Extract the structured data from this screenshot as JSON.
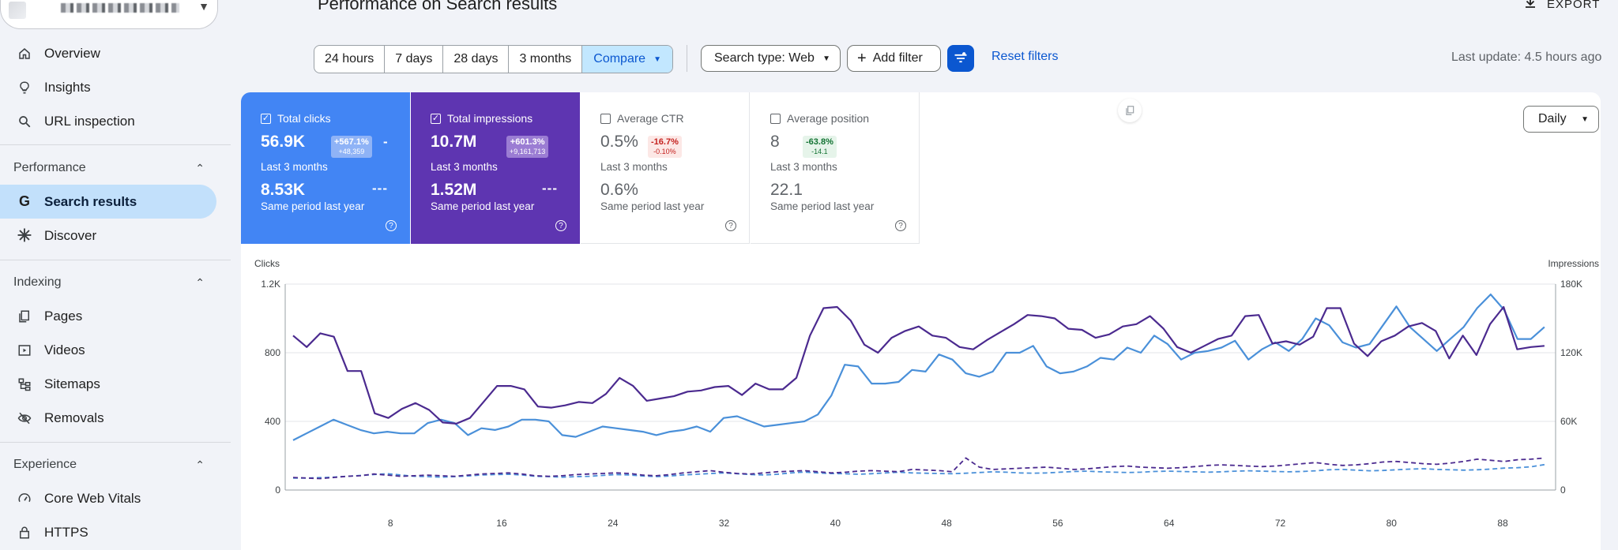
{
  "sidebar": {
    "nav": [
      {
        "label": "Overview",
        "icon": "home-icon"
      },
      {
        "label": "Insights",
        "icon": "lightbulb-icon"
      },
      {
        "label": "URL inspection",
        "icon": "search-icon"
      }
    ],
    "sections": [
      {
        "title": "Performance",
        "items": [
          {
            "label": "Search results",
            "icon": "google-g-icon",
            "active": true
          },
          {
            "label": "Discover",
            "icon": "asterisk-icon"
          }
        ]
      },
      {
        "title": "Indexing",
        "items": [
          {
            "label": "Pages",
            "icon": "pages-icon"
          },
          {
            "label": "Videos",
            "icon": "video-icon"
          },
          {
            "label": "Sitemaps",
            "icon": "sitemap-icon"
          },
          {
            "label": "Removals",
            "icon": "eye-off-icon"
          }
        ]
      },
      {
        "title": "Experience",
        "items": [
          {
            "label": "Core Web Vitals",
            "icon": "gauge-icon"
          },
          {
            "label": "HTTPS",
            "icon": "lock-icon"
          }
        ]
      }
    ]
  },
  "header": {
    "title": "Performance on Search results",
    "export_label": "EXPORT"
  },
  "filters": {
    "ranges": [
      "24 hours",
      "7 days",
      "28 days",
      "3 months"
    ],
    "compare_label": "Compare",
    "search_type": "Search type: Web",
    "add_filter": "Add filter",
    "reset": "Reset filters",
    "last_update": "Last update: 4.5 hours ago"
  },
  "metrics": {
    "clicks": {
      "label": "Total clicks",
      "value": "56.9K",
      "change": "+567.1%",
      "change_abs": "+48,359",
      "extra": "-",
      "period": "Last 3 months",
      "prev_value": "8.53K",
      "prev_period": "Same period last year",
      "dash": "---"
    },
    "impressions": {
      "label": "Total impressions",
      "value": "10.7M",
      "change": "+601.3%",
      "change_abs": "+9,161,713",
      "period": "Last 3 months",
      "prev_value": "1.52M",
      "prev_period": "Same period last year",
      "dash": "---"
    },
    "ctr": {
      "label": "Average CTR",
      "value": "0.5%",
      "change": "-16.7%",
      "change_abs": "-0.10%",
      "period": "Last 3 months",
      "prev_value": "0.6%",
      "prev_period": "Same period last year"
    },
    "position": {
      "label": "Average position",
      "value": "8",
      "change": "-63.8%",
      "change_abs": "-14.1",
      "period": "Last 3 months",
      "prev_value": "22.1",
      "prev_period": "Same period last year"
    }
  },
  "granularity": "Daily",
  "chart_data": {
    "type": "line",
    "left_axis": {
      "label": "Clicks",
      "ticks": [
        "0",
        "400",
        "800",
        "1.2K"
      ],
      "range": [
        0,
        1200
      ]
    },
    "right_axis": {
      "label": "Impressions",
      "ticks": [
        "0",
        "60K",
        "120K",
        "180K"
      ],
      "range": [
        0,
        180000
      ]
    },
    "x_ticks": [
      "8",
      "16",
      "24",
      "32",
      "40",
      "48",
      "56",
      "64",
      "72",
      "80",
      "88"
    ],
    "x_range": [
      1,
      91
    ],
    "grid": true,
    "colors": {
      "clicks": "#4a90d9",
      "impressions": "#4b2a8f"
    },
    "series": [
      {
        "key": "clicks",
        "axis": "left",
        "style": "solid",
        "values": [
          290,
          330,
          370,
          410,
          380,
          350,
          330,
          340,
          330,
          330,
          390,
          410,
          390,
          320,
          360,
          350,
          370,
          410,
          410,
          400,
          320,
          310,
          340,
          370,
          360,
          350,
          340,
          320,
          340,
          350,
          370,
          340,
          420,
          430,
          400,
          370,
          380,
          390,
          400,
          440,
          550,
          730,
          720,
          620,
          620,
          630,
          700,
          690,
          790,
          760,
          680,
          660,
          690,
          800,
          800,
          840,
          720,
          680,
          690,
          720,
          770,
          760,
          830,
          800,
          900,
          850,
          760,
          800,
          810,
          830,
          870,
          760,
          820,
          860,
          810,
          880,
          1000,
          960,
          860,
          830,
          850,
          960,
          1070,
          950,
          880,
          810,
          880,
          950,
          1060,
          1140,
          1050,
          880,
          880,
          950
        ]
      },
      {
        "key": "impressions",
        "axis": "right",
        "style": "solid",
        "values": [
          135000,
          125000,
          137000,
          134000,
          104000,
          104000,
          67000,
          63000,
          71000,
          76000,
          70000,
          59000,
          58000,
          63000,
          77000,
          91000,
          91000,
          88000,
          73000,
          72000,
          74000,
          77000,
          76000,
          84000,
          98000,
          91000,
          78000,
          80000,
          82000,
          86000,
          87000,
          90000,
          91000,
          83000,
          93000,
          88000,
          88000,
          98000,
          135000,
          159000,
          160000,
          148000,
          127000,
          120000,
          133000,
          139000,
          143000,
          135000,
          133000,
          125000,
          123000,
          131000,
          138000,
          145000,
          153000,
          152000,
          150000,
          141000,
          140000,
          133000,
          136000,
          143000,
          145000,
          152000,
          141000,
          125000,
          120000,
          126000,
          132000,
          135000,
          152000,
          153000,
          128000,
          130000,
          127000,
          134000,
          159000,
          159000,
          128000,
          117000,
          130000,
          135000,
          143000,
          146000,
          139000,
          115000,
          135000,
          118000,
          145000,
          160000,
          123000,
          125000,
          126000
        ]
      },
      {
        "key": "clicks_prev",
        "axis": "left",
        "style": "dashed",
        "values": [
          70,
          70,
          72,
          75,
          80,
          85,
          90,
          95,
          88,
          80,
          78,
          75,
          78,
          82,
          88,
          90,
          92,
          88,
          80,
          78,
          75,
          78,
          80,
          85,
          90,
          88,
          82,
          78,
          82,
          88,
          92,
          96,
          100,
          95,
          90,
          88,
          92,
          100,
          105,
          100,
          96,
          95,
          92,
          95,
          100,
          104,
          100,
          98,
          96,
          95,
          98,
          102,
          106,
          104,
          100,
          98,
          100,
          104,
          108,
          110,
          106,
          104,
          102,
          104,
          108,
          110,
          108,
          106,
          104,
          106,
          110,
          112,
          110,
          108,
          106,
          108,
          112,
          118,
          120,
          116,
          112,
          114,
          118,
          122,
          124,
          120,
          118,
          116,
          118,
          122,
          128,
          130,
          135,
          148
        ]
      },
      {
        "key": "impressions_prev",
        "axis": "right",
        "style": "dashed",
        "values": [
          11000,
          10500,
          10000,
          11000,
          12000,
          12500,
          14000,
          13000,
          12000,
          12500,
          13000,
          12500,
          12000,
          13000,
          14000,
          14500,
          15000,
          14000,
          12500,
          12000,
          12500,
          13500,
          14000,
          14500,
          15000,
          14500,
          13000,
          12500,
          13500,
          15000,
          16000,
          17000,
          15500,
          14500,
          14000,
          15000,
          16000,
          16500,
          17000,
          16000,
          15000,
          15500,
          16500,
          17000,
          16500,
          16000,
          18000,
          17500,
          17000,
          16000,
          28000,
          20000,
          18000,
          18500,
          19000,
          19500,
          20000,
          19000,
          18000,
          18500,
          19500,
          20500,
          21000,
          20000,
          19500,
          19000,
          19500,
          20500,
          21500,
          22000,
          21500,
          21000,
          20500,
          21000,
          22000,
          23000,
          24000,
          22500,
          21500,
          22000,
          23000,
          24500,
          25000,
          24000,
          23000,
          22500,
          23500,
          25000,
          27000,
          26000,
          25000,
          26500,
          27000,
          28000
        ]
      }
    ]
  }
}
